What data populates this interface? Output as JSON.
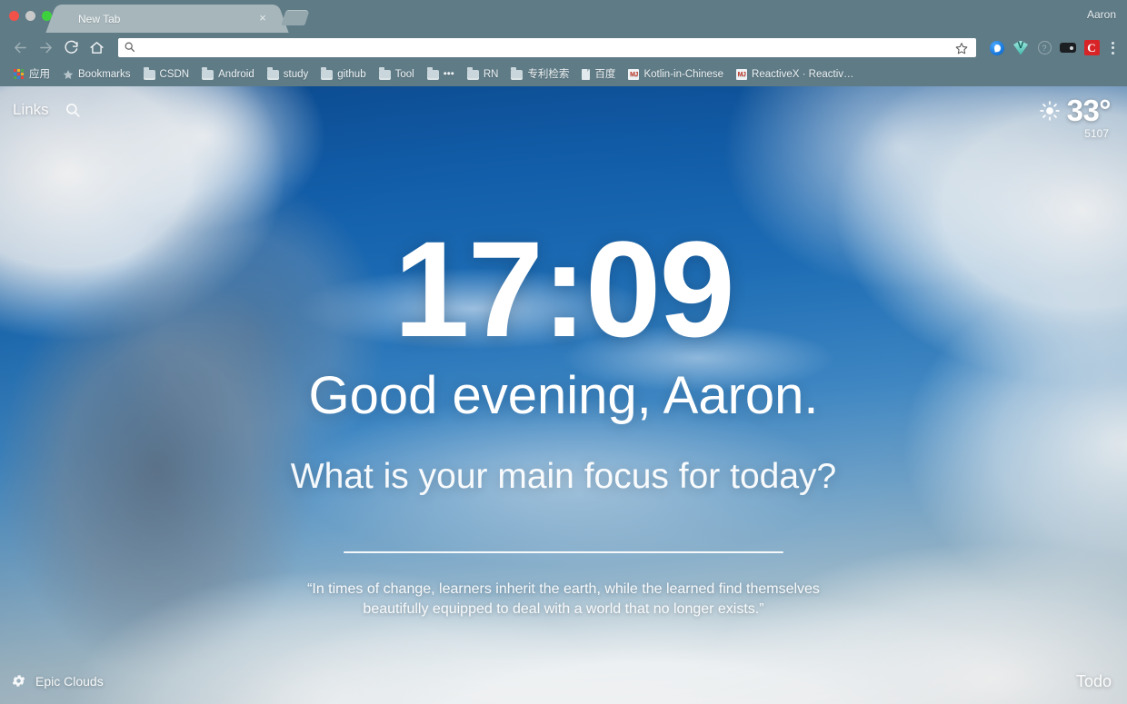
{
  "window": {
    "traffic_lights": [
      "close",
      "minimize",
      "maximize"
    ],
    "profile_name": "Aaron"
  },
  "tabs": [
    {
      "title": "New Tab",
      "close_label": "×",
      "active": true
    }
  ],
  "toolbar": {
    "back_title": "Back",
    "forward_title": "Forward",
    "reload_title": "Reload",
    "home_title": "Home",
    "omnibox": {
      "value": "",
      "placeholder": ""
    },
    "bookmark_star_title": "Bookmark this page",
    "extensions": [
      {
        "name": "pocket-extension",
        "icon": "blue-circle-icon"
      },
      {
        "name": "vimium-extension",
        "icon": "green-diamond-v-icon"
      },
      {
        "name": "help-extension",
        "icon": "question-circle-icon"
      },
      {
        "name": "tag-extension",
        "icon": "dark-tag-icon"
      },
      {
        "name": "c-extension",
        "icon": "red-c-icon"
      }
    ],
    "menu_title": "Customize and control Google Chrome"
  },
  "bookmarks": [
    {
      "label": "应用",
      "icon": "apps-grid-icon"
    },
    {
      "label": "Bookmarks",
      "icon": "star-icon"
    },
    {
      "label": "CSDN",
      "icon": "folder-icon"
    },
    {
      "label": "Android",
      "icon": "folder-icon"
    },
    {
      "label": "study",
      "icon": "folder-icon"
    },
    {
      "label": "github",
      "icon": "folder-icon"
    },
    {
      "label": "Tool",
      "icon": "folder-icon"
    },
    {
      "label": "•••",
      "icon": "folder-icon"
    },
    {
      "label": "RN",
      "icon": "folder-icon"
    },
    {
      "label": "专利检索",
      "icon": "folder-icon"
    },
    {
      "label": "百度",
      "icon": "document-icon"
    },
    {
      "label": "Kotlin-in-Chinese",
      "icon": "book-icon"
    },
    {
      "label": "ReactiveX · Reactiv…",
      "icon": "book-icon"
    }
  ],
  "newtab": {
    "links_label": "Links",
    "search_icon": "search-icon",
    "weather": {
      "icon": "sun-icon",
      "temperature": "33°",
      "location": "5107"
    },
    "clock": "17:09",
    "greeting": "Good evening, Aaron.",
    "focus_question": "What is your main focus for today?",
    "quote": "“In times of change, learners inherit the earth, while the learned find themselves beautifully equipped to deal with a world that no longer exists.”",
    "photo_name": "Epic Clouds",
    "settings_icon": "gear-icon",
    "todo_label": "Todo"
  },
  "colors": {
    "chrome_bg": "#5f7b86",
    "tab_active": "#a7b6bb",
    "sky_deep_blue": "#0c4d94",
    "sky_mid_blue": "#1d6cb4",
    "cloud_white": "#ffffff",
    "text_white": "#ffffff",
    "ext_red": "#d82327",
    "ext_blue": "#1574d8",
    "ext_green": "#3fb7a8"
  }
}
